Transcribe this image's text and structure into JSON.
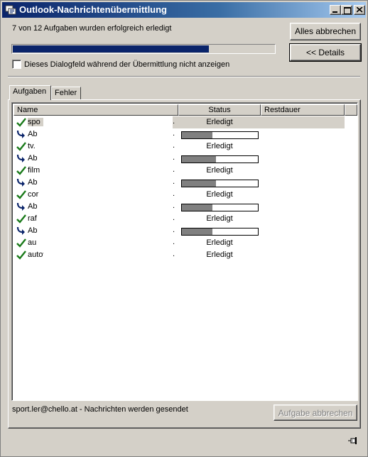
{
  "window": {
    "title": "Outlook-Nachrichtenübermittlung",
    "titlebar_color": "#0a246a"
  },
  "summary": {
    "status_text": "7 von 12 Aufgaben wurden erfolgreich erledigt",
    "progress": 0.75
  },
  "buttons": {
    "cancel_all": "Alles abbrechen",
    "details": "<< Details",
    "cancel_task": "Aufgabe abbrechen"
  },
  "options": {
    "hide_dialog_label": "Dieses Dialogfeld während der Übermittlung nicht anzeigen",
    "hide_dialog_checked": false
  },
  "tabs": [
    {
      "label": "Aufgaben",
      "active": true
    },
    {
      "label": "Fehler",
      "active": false
    }
  ],
  "columns": {
    "name": "Name",
    "status": "Status",
    "remaining": "Restdauer"
  },
  "rows": [
    {
      "icon": "check-icon",
      "name": "spo",
      "status": "Erledigt",
      "selected": true
    },
    {
      "icon": "arrow-icon",
      "name": "Ab",
      "progress": 0.4
    },
    {
      "icon": "check-icon",
      "name": "tv.",
      "status": "Erledigt"
    },
    {
      "icon": "arrow-icon",
      "name": "Ab",
      "progress": 0.45
    },
    {
      "icon": "check-icon",
      "name": "film",
      "status": "Erledigt"
    },
    {
      "icon": "arrow-icon",
      "name": "Ab",
      "progress": 0.45
    },
    {
      "icon": "check-icon",
      "name": "cor",
      "status": "Erledigt"
    },
    {
      "icon": "arrow-icon",
      "name": "Ab",
      "progress": 0.4
    },
    {
      "icon": "check-icon",
      "name": "raf",
      "status": "Erledigt"
    },
    {
      "icon": "arrow-icon",
      "name": "Ab",
      "progress": 0.4
    },
    {
      "icon": "check-icon",
      "name": "au",
      "status": "Erledigt"
    },
    {
      "icon": "check-icon",
      "name": "autoweit@chello.at - Nachrichten werden...",
      "status": "Erledigt"
    }
  ],
  "footer": {
    "status_text": "sport.ler@chello.at - Nachrichten werden gesendet"
  }
}
